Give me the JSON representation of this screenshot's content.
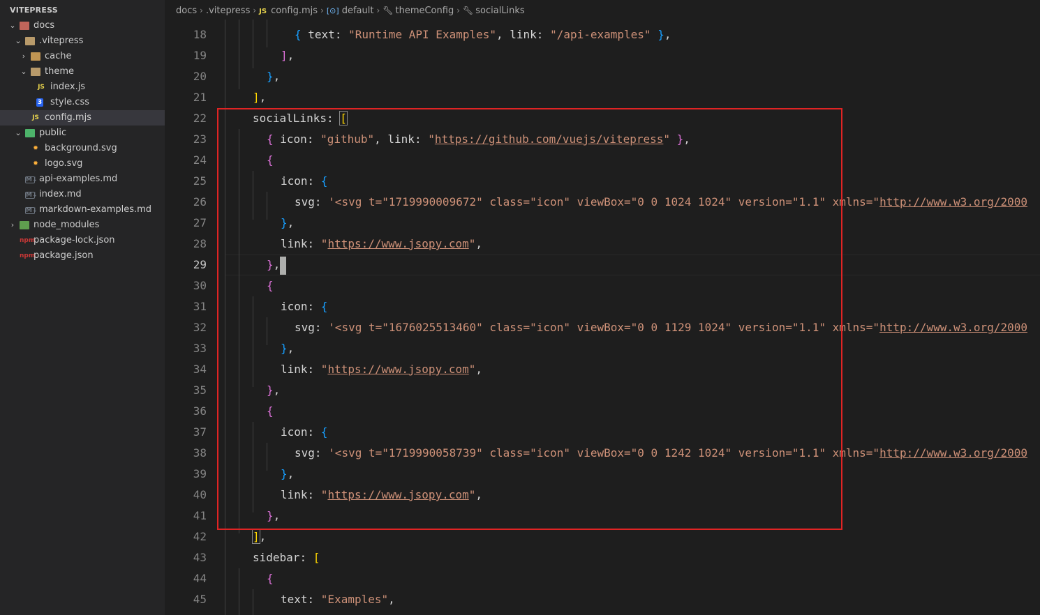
{
  "explorer": {
    "title": "VITEPRESS",
    "items": [
      {
        "label": "docs",
        "icon": "folder-open-icon",
        "kind": "folder-docs",
        "chev": "⌄"
      },
      {
        "label": ".vitepress",
        "icon": "folder-open-icon",
        "kind": "folder-vp",
        "chev": "⌄"
      },
      {
        "label": "cache",
        "icon": "folder-icon",
        "kind": "folder",
        "chev": "›"
      },
      {
        "label": "theme",
        "icon": "folder-open-icon",
        "kind": "folder-vp",
        "chev": "⌄"
      },
      {
        "label": "index.js",
        "icon": "js-file-icon",
        "kind": "js",
        "icon_text": "JS"
      },
      {
        "label": "style.css",
        "icon": "css-file-icon",
        "kind": "css",
        "icon_text": "3"
      },
      {
        "label": "config.mjs",
        "icon": "js-file-icon",
        "kind": "js",
        "icon_text": "JS",
        "selected": true
      },
      {
        "label": "public",
        "icon": "folder-open-icon",
        "kind": "folder-pub",
        "chev": "⌄"
      },
      {
        "label": "background.svg",
        "icon": "svg-file-icon",
        "kind": "svg",
        "icon_text": "✹"
      },
      {
        "label": "logo.svg",
        "icon": "svg-file-icon",
        "kind": "svg",
        "icon_text": "✹"
      },
      {
        "label": "api-examples.md",
        "icon": "markdown-file-icon",
        "kind": "md",
        "icon_text": "M↓"
      },
      {
        "label": "index.md",
        "icon": "markdown-file-icon",
        "kind": "md",
        "icon_text": "M↓"
      },
      {
        "label": "markdown-examples.md",
        "icon": "markdown-file-icon",
        "kind": "md",
        "icon_text": "M↓"
      },
      {
        "label": "node_modules",
        "icon": "folder-icon",
        "kind": "folder-nm",
        "chev": "›"
      },
      {
        "label": "package-lock.json",
        "icon": "npm-file-icon",
        "kind": "json",
        "icon_text": "npm"
      },
      {
        "label": "package.json",
        "icon": "npm-file-icon",
        "kind": "json",
        "icon_text": "npm"
      }
    ]
  },
  "breadcrumb": {
    "docs": "docs",
    "vitepress": ".vitepress",
    "js_badge": "JS",
    "file": "config.mjs",
    "obj_badge": "[⊙]",
    "default": "default",
    "themeConfig": "themeConfig",
    "socialLinks": "socialLinks"
  },
  "editor": {
    "active_line": "29",
    "line_numbers": [
      "18",
      "19",
      "20",
      "21",
      "22",
      "23",
      "24",
      "25",
      "26",
      "27",
      "28",
      "29",
      "30",
      "31",
      "32",
      "33",
      "34",
      "35",
      "36",
      "37",
      "38",
      "39",
      "40",
      "41",
      "42",
      "43",
      "44",
      "45"
    ],
    "strings": {
      "l18_text": "\"Runtime API Examples\"",
      "l18_link": "\"/api-examples\"",
      "github": "\"github\"",
      "github_url": "https://github.com/vuejs/vitepress",
      "svg1": "'<svg t=\"1719990009672\" class=\"icon\" viewBox=\"0 0 1024 1024\" version=\"1.1\" xmlns=\"",
      "svg2": "'<svg t=\"1676025513460\" class=\"icon\" viewBox=\"0 0 1129 1024\" version=\"1.1\" xmlns=\"",
      "svg3": "'<svg t=\"1719990058739\" class=\"icon\" viewBox=\"0 0 1242 1024\" version=\"1.1\" xmlns=\"",
      "w3_url": "http://www.w3.org/2000",
      "jsopy_url": "https://www.jsopy.com",
      "examples": "\"Examples\""
    },
    "keys": {
      "text": "text",
      "link": "link",
      "icon": "icon",
      "svg": "svg",
      "socialLinks": "socialLinks",
      "sidebar": "sidebar"
    }
  },
  "colors": {
    "highlight_box": "#e02424",
    "string": "#ce9178",
    "bracket1": "#ffd700",
    "bracket2": "#da70d6",
    "bracket3": "#179fff"
  }
}
